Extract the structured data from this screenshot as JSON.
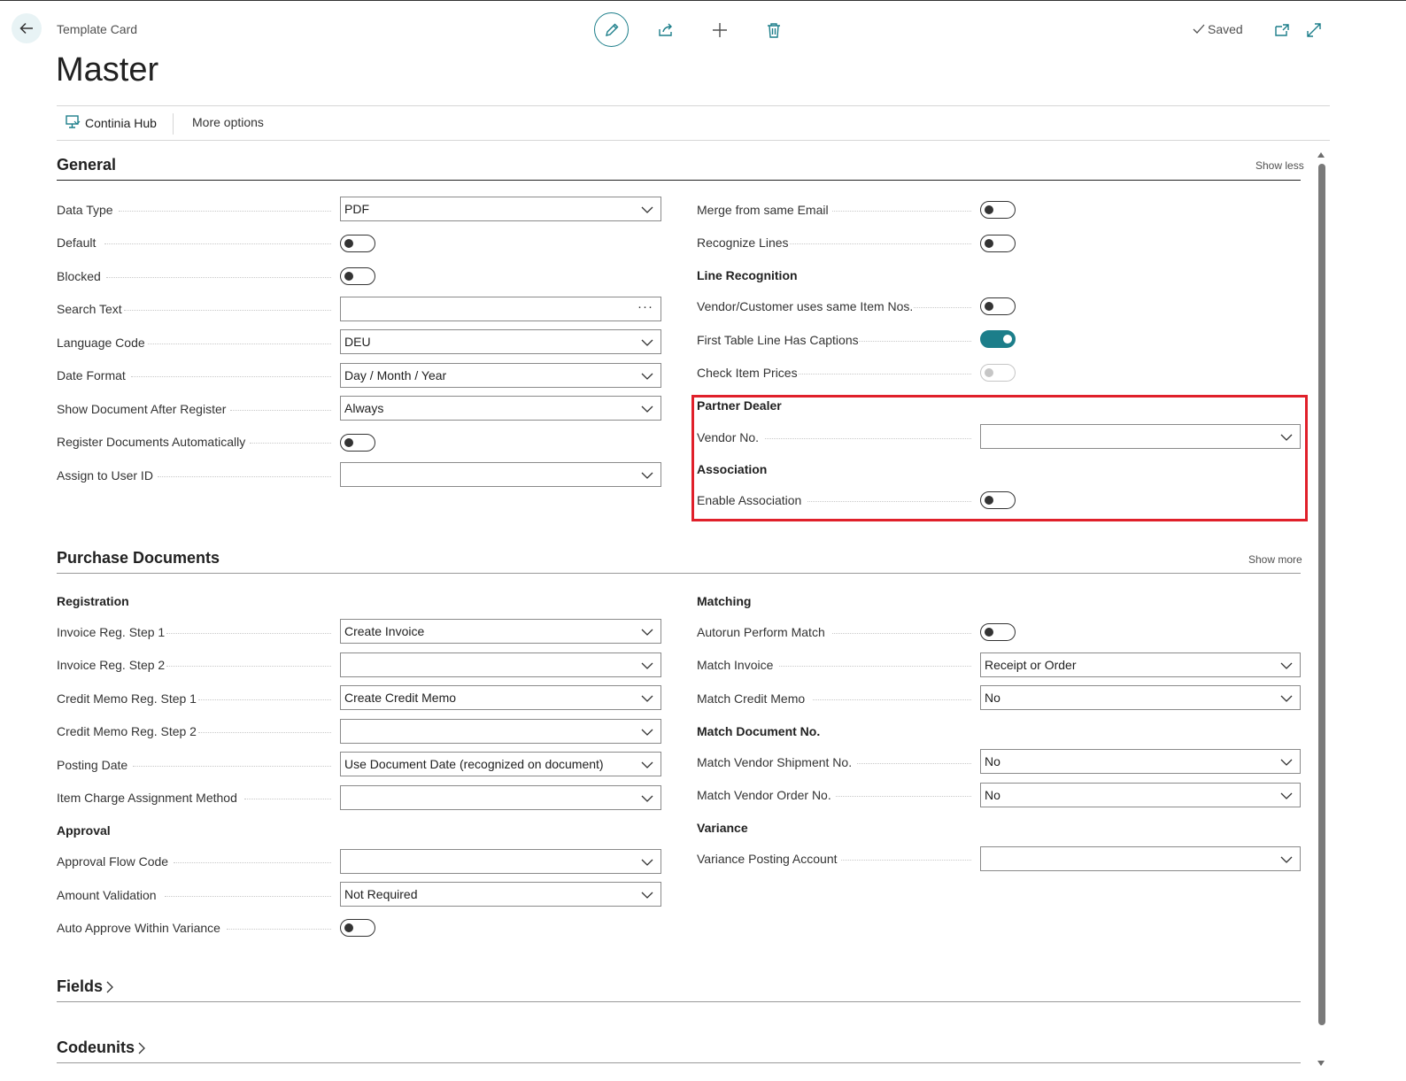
{
  "header": {
    "caption": "Template Card",
    "title": "Master",
    "status": "Saved"
  },
  "actions": {
    "hub_label": "Continia Hub",
    "more_label": "More options"
  },
  "general": {
    "title": "General",
    "toggle_link": "Show less",
    "left": [
      {
        "label": "Data Type",
        "type": "select",
        "value": "PDF"
      },
      {
        "label": "Default",
        "type": "toggle",
        "value": false
      },
      {
        "label": "Blocked",
        "type": "toggle",
        "value": false
      },
      {
        "label": "Search Text",
        "type": "lookup",
        "value": ""
      },
      {
        "label": "Language Code",
        "type": "select",
        "value": "DEU"
      },
      {
        "label": "Date Format",
        "type": "select",
        "value": "Day / Month / Year"
      },
      {
        "label": "Show Document After Register",
        "type": "select",
        "value": "Always"
      },
      {
        "label": "Register Documents Automatically",
        "type": "toggle",
        "value": false
      },
      {
        "label": "Assign to User ID",
        "type": "select",
        "value": ""
      }
    ],
    "right": {
      "merge_from_same_email": {
        "label": "Merge from same Email",
        "value": false
      },
      "recognize_lines": {
        "label": "Recognize Lines",
        "value": false
      },
      "line_recognition_head": "Line Recognition",
      "vendor_same_item_nos": {
        "label": "Vendor/Customer uses same Item Nos.",
        "value": false
      },
      "first_table_line_captions": {
        "label": "First Table Line Has Captions",
        "value": true
      },
      "check_item_prices": {
        "label": "Check Item Prices",
        "value": false
      },
      "partner_dealer_head": "Partner Dealer",
      "vendor_no": {
        "label": "Vendor No.",
        "value": ""
      },
      "association_head": "Association",
      "enable_association": {
        "label": "Enable Association",
        "value": false
      }
    }
  },
  "purchase": {
    "title": "Purchase Documents",
    "toggle_link": "Show more",
    "registration_head": "Registration",
    "approval_head": "Approval",
    "left": [
      {
        "label": "Invoice Reg. Step 1",
        "type": "select",
        "value": "Create Invoice"
      },
      {
        "label": "Invoice Reg. Step 2",
        "type": "select",
        "value": ""
      },
      {
        "label": "Credit Memo Reg. Step 1",
        "type": "select",
        "value": "Create Credit Memo"
      },
      {
        "label": "Credit Memo Reg. Step 2",
        "type": "select",
        "value": ""
      },
      {
        "label": "Posting Date",
        "type": "select",
        "value": "Use Document Date (recognized on document)"
      },
      {
        "label": "Item Charge Assignment Method",
        "type": "select",
        "value": ""
      },
      {
        "label": "Approval Flow Code",
        "type": "select",
        "value": ""
      },
      {
        "label": "Amount Validation",
        "type": "select",
        "value": "Not Required"
      },
      {
        "label": "Auto Approve Within Variance",
        "type": "toggle",
        "value": false
      }
    ],
    "matching_head": "Matching",
    "match_doc_head": "Match Document No.",
    "variance_head": "Variance",
    "right": [
      {
        "label": "Autorun Perform Match",
        "type": "toggle",
        "value": false
      },
      {
        "label": "Match Invoice",
        "type": "select",
        "value": "Receipt or Order"
      },
      {
        "label": "Match Credit Memo",
        "type": "select",
        "value": "No"
      },
      {
        "label": "Match Vendor Shipment No.",
        "type": "select",
        "value": "No"
      },
      {
        "label": "Match Vendor Order No.",
        "type": "select",
        "value": "No"
      },
      {
        "label": "Variance Posting Account",
        "type": "select",
        "value": ""
      }
    ]
  },
  "fields_section": {
    "title": "Fields"
  },
  "codeunits_section": {
    "title": "Codeunits"
  },
  "colors": {
    "accent": "#1c7e8a",
    "highlight": "#e0202a"
  }
}
